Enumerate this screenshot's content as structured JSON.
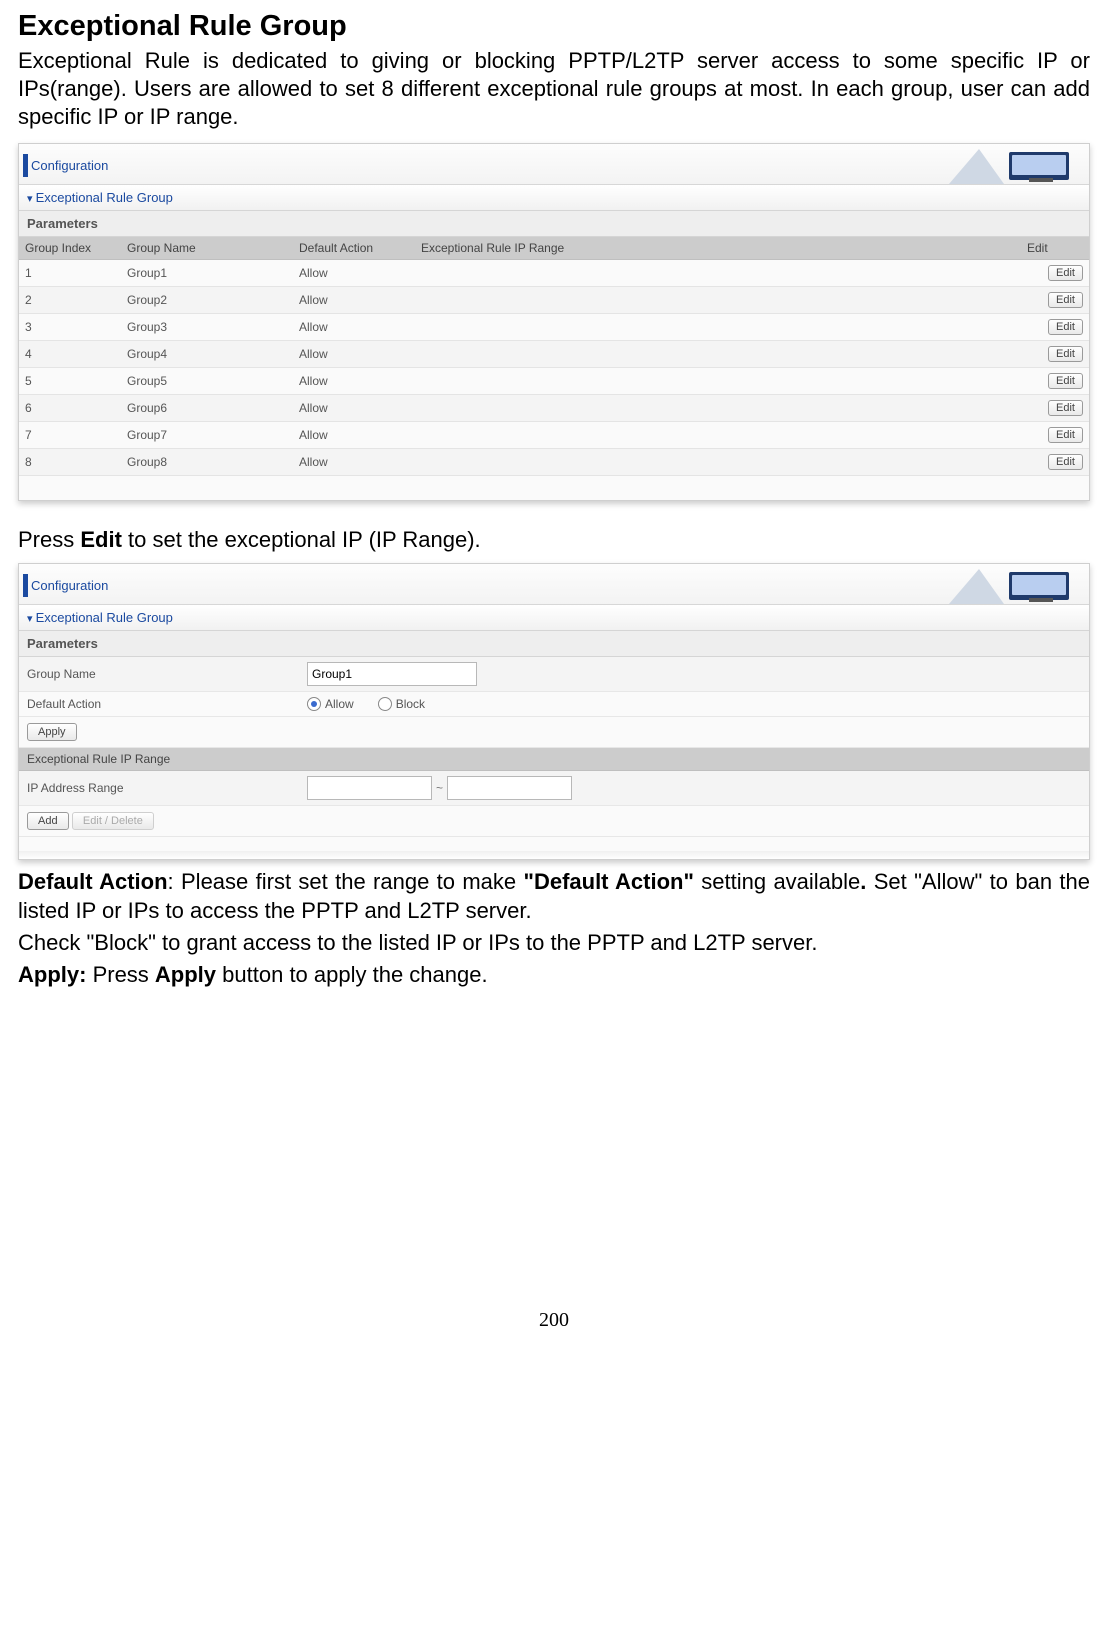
{
  "title": "Exceptional Rule Group",
  "intro": "Exceptional Rule is dedicated to giving or blocking PPTP/L2TP server access to some specific IP or IPs(range). Users are allowed to set 8 different exceptional rule groups at most. In each group, user can add specific IP or IP range.",
  "mid_text_pre": "Press ",
  "mid_text_bold": "Edit",
  "mid_text_post": " to set the exceptional IP (IP Range).",
  "screenshot1": {
    "config_label": "Configuration",
    "section_label": "Exceptional Rule Group",
    "parameters_label": "Parameters",
    "headers": {
      "idx": "Group Index",
      "name": "Group Name",
      "action": "Default Action",
      "range": "Exceptional Rule IP Range",
      "edit": "Edit"
    },
    "edit_btn": "Edit",
    "rows": [
      {
        "idx": "1",
        "name": "Group1",
        "action": "Allow",
        "range": ""
      },
      {
        "idx": "2",
        "name": "Group2",
        "action": "Allow",
        "range": ""
      },
      {
        "idx": "3",
        "name": "Group3",
        "action": "Allow",
        "range": ""
      },
      {
        "idx": "4",
        "name": "Group4",
        "action": "Allow",
        "range": ""
      },
      {
        "idx": "5",
        "name": "Group5",
        "action": "Allow",
        "range": ""
      },
      {
        "idx": "6",
        "name": "Group6",
        "action": "Allow",
        "range": ""
      },
      {
        "idx": "7",
        "name": "Group7",
        "action": "Allow",
        "range": ""
      },
      {
        "idx": "8",
        "name": "Group8",
        "action": "Allow",
        "range": ""
      }
    ]
  },
  "screenshot2": {
    "config_label": "Configuration",
    "section_label": "Exceptional Rule Group",
    "parameters_label": "Parameters",
    "group_name_label": "Group Name",
    "group_name_value": "Group1",
    "default_action_label": "Default Action",
    "allow_label": "Allow",
    "block_label": "Block",
    "apply_label": "Apply",
    "ip_range_header": "Exceptional Rule IP Range",
    "ip_range_label": "IP Address Range",
    "ip_from": "",
    "ip_to": "",
    "tilde": "~",
    "add_label": "Add",
    "editdel_label": "Edit / Delete"
  },
  "footer": {
    "p1_b1": "Default Action",
    "p1_mid1": ": Please first set the range to make ",
    "p1_b2": "\"Default Action\"",
    "p1_mid2": " setting available",
    "p1_b3": ".",
    "p1_post": " Set \"Allow\" to ban the listed IP or IPs to access the PPTP and L2TP server.",
    "p2": "Check \"Block\" to grant access to the listed IP or IPs to the PPTP and L2TP server.",
    "p3_b1": "Apply:",
    "p3_mid": " Press ",
    "p3_b2": "Apply",
    "p3_post": " button to apply the change."
  },
  "page_number": "200"
}
